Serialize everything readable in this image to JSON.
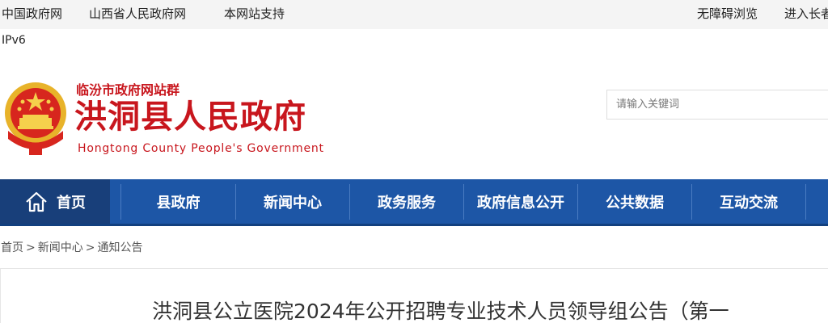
{
  "topbar": {
    "links": [
      "中国政府网",
      "山西省人民政府网",
      "本网站支持"
    ],
    "right_links": [
      "无障碍浏览",
      "进入长者"
    ]
  },
  "ipv6_label": "IPv6",
  "header": {
    "site_group": "临汾市政府网站群",
    "title": "洪洞县人民政府",
    "title_en": "Hongtong County People's Government",
    "search_placeholder": "请输入关键词"
  },
  "nav": {
    "items": [
      "首页",
      "县政府",
      "新闻中心",
      "政务服务",
      "政府信息公开",
      "公共数据",
      "互动交流"
    ]
  },
  "breadcrumb": {
    "items": [
      "首页",
      "新闻中心",
      "通知公告"
    ],
    "separator": ">"
  },
  "article": {
    "title": "洪洞县公立医院2024年公开招聘专业技术人员领导组公告（第一"
  },
  "colors": {
    "brand_red": "#c8161d",
    "nav_blue": "#1d56a6",
    "nav_home": "#183f7a",
    "topbar_bg": "#f4f4f4"
  }
}
